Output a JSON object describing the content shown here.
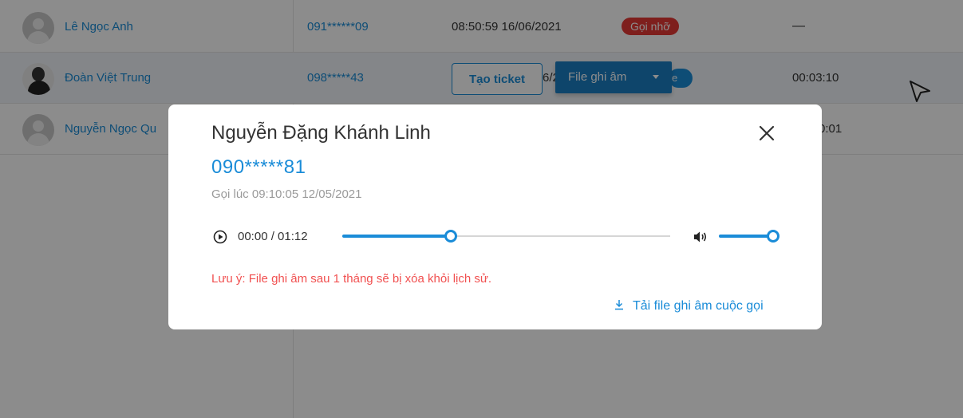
{
  "table": {
    "rows": [
      {
        "name": "Lê Ngọc Anh",
        "phone": "091******09",
        "time": "08:50:59 16/06/2021",
        "status": "Gọi nhỡ",
        "duration": "—"
      },
      {
        "name": "Đoàn Việt Trung",
        "phone": "098*****43",
        "time_fragment": "6/2",
        "status_fragment": "e",
        "duration": "00:03:10",
        "actions": {
          "ticket_label": "Tạo ticket",
          "file_label": "File ghi âm"
        }
      },
      {
        "name": "Nguyễn Ngọc Qu",
        "duration": "0:01"
      }
    ]
  },
  "modal": {
    "title": "Nguyễn Đặng Khánh Linh",
    "phone": "090*****81",
    "call_time": "Gọi lúc 09:10:05 12/05/2021",
    "player": {
      "time_display": "00:00 / 01:12",
      "progress_percent": 33,
      "volume_percent": 100
    },
    "note": "Lưu ý: File ghi âm sau 1 tháng sẽ bị xóa khỏi lịch sử.",
    "download_label": "Tải file ghi âm cuộc gọi"
  },
  "colors": {
    "accent": "#1a8cd8",
    "missed": "#e53935",
    "warning_text": "#f15050"
  },
  "icons": [
    "close-icon",
    "play-circle-icon",
    "volume-icon",
    "download-icon",
    "mouse-cursor-icon",
    "caret-down-icon"
  ]
}
